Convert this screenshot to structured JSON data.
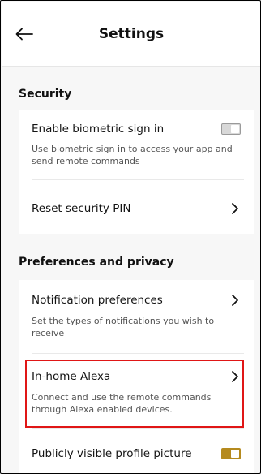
{
  "header": {
    "title": "Settings"
  },
  "security": {
    "heading": "Security",
    "biometric": {
      "label": "Enable biometric sign in",
      "description": "Use biometric sign in to access your app and send remote commands",
      "enabled": false
    },
    "reset_pin": {
      "label": "Reset security PIN"
    }
  },
  "preferences": {
    "heading": "Preferences and privacy",
    "notifications": {
      "label": "Notification preferences",
      "description": "Set the types of notifications you wish to receive"
    },
    "alexa": {
      "label": "In-home Alexa",
      "description": "Connect and use the remote commands through Alexa enabled devices."
    },
    "profile_picture": {
      "label": "Publicly visible profile picture",
      "enabled": true
    }
  },
  "colors": {
    "accent": "#b58a1e",
    "highlight": "#e01616",
    "background": "#f7f7f7"
  },
  "icons": {
    "back": "arrow-left-icon",
    "chevron": "chevron-right-icon"
  }
}
